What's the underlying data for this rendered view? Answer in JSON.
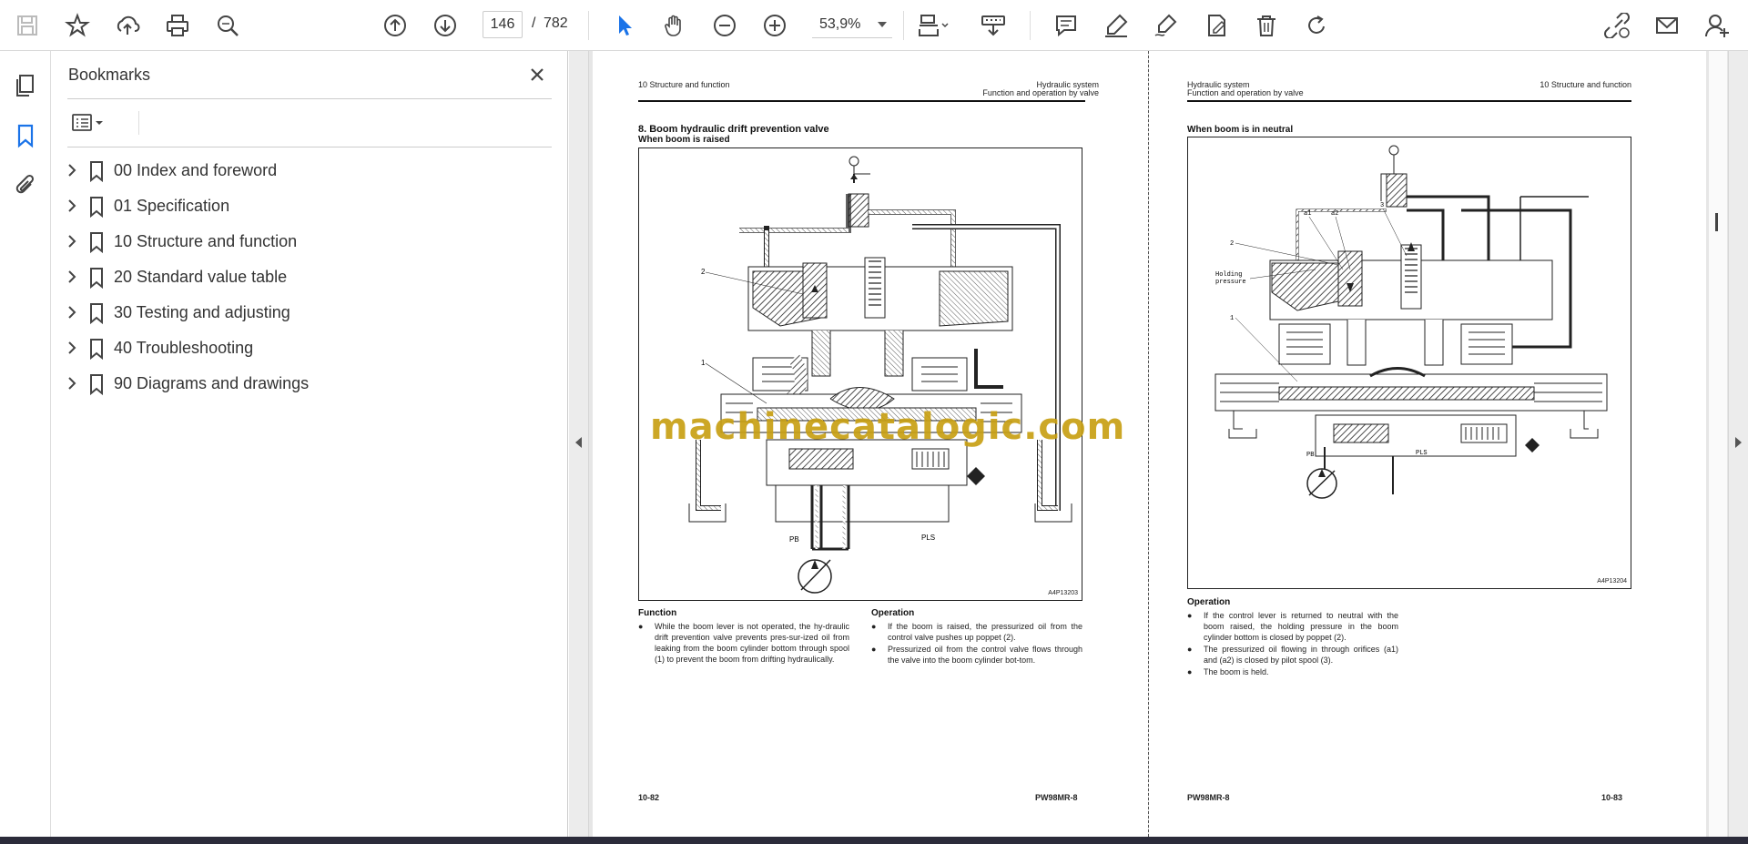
{
  "toolbar": {
    "current_page": "146",
    "page_separator": "/",
    "total_pages": "782",
    "zoom": "53,9%"
  },
  "sidebar": {
    "title": "Bookmarks",
    "items": [
      {
        "label": "00 Index and foreword"
      },
      {
        "label": "01 Specification"
      },
      {
        "label": "10 Structure and function"
      },
      {
        "label": "20 Standard value table"
      },
      {
        "label": "30 Testing and adjusting"
      },
      {
        "label": "40 Troubleshooting"
      },
      {
        "label": "90 Diagrams and drawings"
      }
    ]
  },
  "left_page": {
    "header_left": "10 Structure and function",
    "header_right_1": "Hydraulic system",
    "header_right_2": "Function and operation by valve",
    "section_title": "8. Boom hydraulic drift prevention valve",
    "subtitle": "When boom is raised",
    "figure_code": "A4P13203",
    "fig_labels": {
      "l1": "1",
      "l2": "2",
      "pb": "PB",
      "pls": "PLS"
    },
    "function_heading": "Function",
    "function_bullets": [
      "While the boom lever is not operated, the hy-draulic drift prevention valve prevents pres-sur-ized oil from leaking from the boom cylinder bottom through spool (1) to prevent the boom from drifting hydraulically."
    ],
    "operation_heading": "Operation",
    "operation_bullets": [
      "If the boom is raised, the pressurized oil from the control valve pushes up poppet (2).",
      "Pressurized oil from the control valve flows through the valve into the boom cylinder bot-tom."
    ],
    "footer_left": "10-82",
    "footer_right": "PW98MR-8"
  },
  "right_page": {
    "header_left_1": "Hydraulic system",
    "header_left_2": "Function and operation by valve",
    "header_right": "10 Structure and function",
    "subtitle": "When boom is in neutral",
    "figure_code": "A4P13204",
    "fig_labels": {
      "a1": "a1",
      "a2": "a2",
      "l1": "1",
      "l2": "2",
      "l3": "3",
      "hold1": "Holding",
      "hold2": "pressure",
      "pb": "PB",
      "pls": "PLS"
    },
    "operation_heading": "Operation",
    "operation_bullets": [
      "If the control lever is returned to neutral with the boom raised, the holding pressure in the boom cylinder bottom is closed by poppet (2).",
      "The pressurized oil flowing in through orifices (a1) and (a2) is closed by pilot spool (3).",
      "The boom is held."
    ],
    "footer_left": "PW98MR-8",
    "footer_right": "10-83"
  },
  "watermark": "machinecatalogic.com",
  "icons": [
    "save-icon",
    "star-icon",
    "upload-icon",
    "print-icon",
    "zoom-search-icon",
    "prev-page-icon",
    "next-page-icon",
    "select-cursor-icon",
    "hand-icon",
    "zoom-out-icon",
    "zoom-in-icon",
    "page-fit-icon",
    "scroll-mode-icon",
    "comment-icon",
    "highlight-icon",
    "sign-icon",
    "edit-icon",
    "delete-icon",
    "rotate-icon",
    "share-link-icon",
    "mail-icon",
    "account-icon"
  ]
}
